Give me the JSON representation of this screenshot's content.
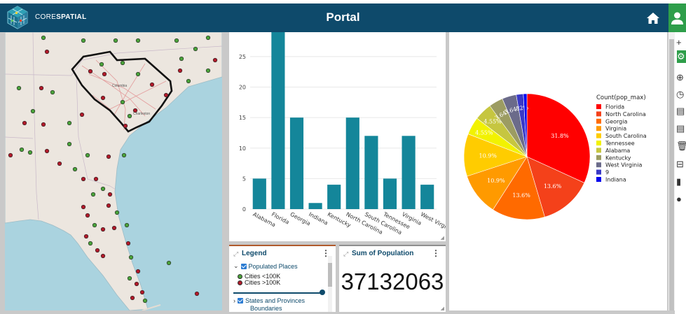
{
  "header": {
    "brand_light": "CORE",
    "brand_bold": "SPATIAL",
    "title": "Portal",
    "home_icon": "home-icon",
    "user_icon": "user-icon"
  },
  "map": {
    "basemap": "southeast-us",
    "boundary_label_sc": "Columbia",
    "boundary_label_ch": "Charleston"
  },
  "bar_chart": {
    "chart_data": {
      "type": "bar",
      "categories": [
        "Alabama",
        "Florida",
        "Georgia",
        "Indiana",
        "Kentucky",
        "North Carolina",
        "South Carolina",
        "Tennessee",
        "Virginia",
        "West Virginia"
      ],
      "values": [
        5,
        29,
        15,
        1,
        4,
        15,
        12,
        5,
        12,
        4
      ],
      "yticks": [
        0,
        5,
        10,
        15,
        20,
        25
      ],
      "ylim": [
        0,
        29
      ],
      "color": "#14869a"
    }
  },
  "pie_chart": {
    "chart_data": {
      "type": "pie",
      "legend_title": "Count(pop_max)",
      "legend_labels": [
        "Florida",
        "North Carolina",
        "Georgia",
        "Virginia",
        "South Carolina",
        "Tennessee",
        "Alabama",
        "Kentucky",
        "West Virginia",
        "9",
        "Indiana"
      ],
      "slices": [
        {
          "label": "Florida",
          "value": 31.8,
          "text": "31.8%",
          "color": "#ff0000"
        },
        {
          "label": "North Carolina",
          "value": 13.6,
          "text": "13.6%",
          "color": "#f4411a"
        },
        {
          "label": "Georgia",
          "value": 13.6,
          "text": "13.6%",
          "color": "#ff6a00"
        },
        {
          "label": "Virginia",
          "value": 10.9,
          "text": "10.9%",
          "color": "#ff9a00"
        },
        {
          "label": "South Carolina",
          "value": 10.9,
          "text": "10.9%",
          "color": "#ffcc00"
        },
        {
          "label": "Tennessee",
          "value": 4.55,
          "text": "4.55%",
          "color": "#f2f200"
        },
        {
          "label": "Alabama",
          "value": 4.55,
          "text": "4.55%",
          "color": "#c6c640"
        },
        {
          "label": "Kentucky",
          "value": 3.64,
          "text": "3.64%",
          "color": "#9c9c62"
        },
        {
          "label": "West Virginia",
          "value": 3.64,
          "text": "3.64%",
          "color": "#6b6b8a"
        },
        {
          "label": "9",
          "value": 1.82,
          "text": ".82%",
          "color": "#3838c6"
        },
        {
          "label": "Indiana",
          "value": 0.91,
          "text": "",
          "color": "#0000ee"
        }
      ]
    }
  },
  "legend_panel": {
    "title": "Legend",
    "layer1": "Populated Places",
    "item1": "Cities <100K",
    "item2": "Cities >100K",
    "layer2_line1": "States and Provinces",
    "layer2_line2": "Boundaries"
  },
  "sum_panel": {
    "title": "Sum of Population",
    "value": "37132063"
  },
  "toolbar": {
    "tools": [
      "plus-icon",
      "settings-icon",
      "add-circle-icon",
      "clock-icon",
      "save-icon",
      "save-as-icon",
      "trash-icon",
      "export-icon",
      "bookmark-icon",
      "info-icon"
    ]
  }
}
